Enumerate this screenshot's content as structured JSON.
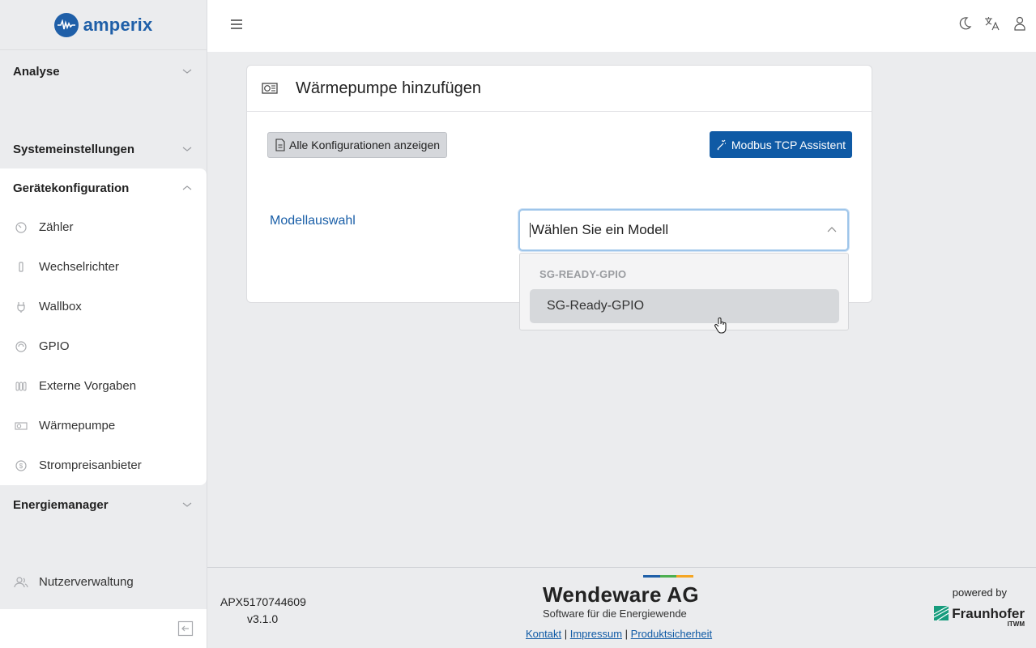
{
  "brand": {
    "name": "amperix"
  },
  "sidebar": {
    "sections": {
      "analyse": "Analyse",
      "systemeinstellungen": "Systemeinstellungen",
      "geraetekonfiguration": "Gerätekonfiguration",
      "energiemanager": "Energiemanager"
    },
    "items": [
      {
        "label": "Zähler",
        "icon": "gauge-icon"
      },
      {
        "label": "Wechselrichter",
        "icon": "inverter-icon"
      },
      {
        "label": "Wallbox",
        "icon": "plug-icon"
      },
      {
        "label": "GPIO",
        "icon": "gpio-icon"
      },
      {
        "label": "Externe Vorgaben",
        "icon": "sliders-icon"
      },
      {
        "label": "Wärmepumpe",
        "icon": "heat-pump-icon"
      },
      {
        "label": "Strompreisanbieter",
        "icon": "dollar-coin-icon"
      }
    ],
    "nutzerverwaltung": "Nutzerverwaltung"
  },
  "card": {
    "title": "Wärmepumpe hinzufügen",
    "show_all_button": "Alle Konfigurationen anzeigen",
    "modbus_button": "Modbus TCP Assistent",
    "field_label": "Modellauswahl"
  },
  "select": {
    "placeholder": "Wählen Sie ein Modell",
    "group_label": "SG-READY-GPIO",
    "option": "SG-Ready-GPIO"
  },
  "footer": {
    "serial": "APX5170744609",
    "version": "v3.1.0",
    "company": "Wendeware AG",
    "tagline": "Software für die Energiewende",
    "links": [
      "Kontakt",
      "Impressum",
      "Produktsicherheit"
    ],
    "separator": "|",
    "powered_by": "powered by",
    "partner": "Fraunhofer",
    "partner_sub": "ITWM"
  },
  "colors": {
    "primary": "#0f5aa5",
    "brand": "#1f5fa8",
    "wendeware_bar": [
      "#1f5fa8",
      "#4caf50",
      "#f5a623"
    ]
  }
}
